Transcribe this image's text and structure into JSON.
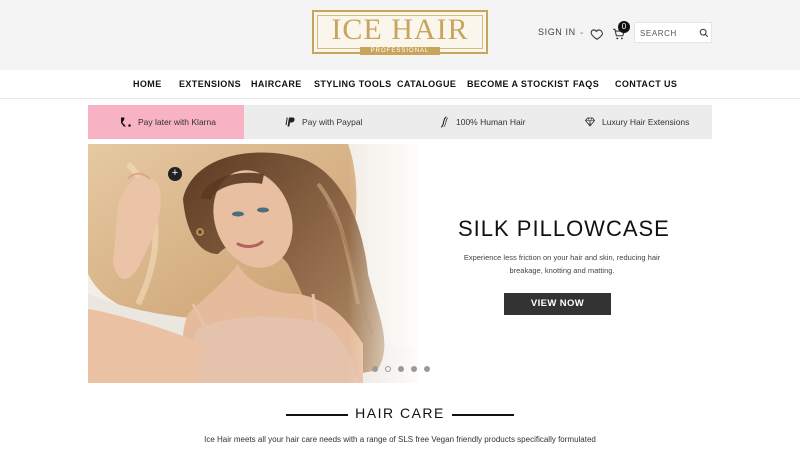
{
  "brand": {
    "logo_text": "ICE HAIR",
    "logo_subtext": "PROFESSIONAL",
    "gold": "#c9a55c"
  },
  "header": {
    "signin_label": "SIGN IN",
    "cart_count": "0",
    "search_placeholder": "SEARCH"
  },
  "nav": {
    "items": [
      {
        "label": "HOME"
      },
      {
        "label": "EXTENSIONS"
      },
      {
        "label": "HAIRCARE"
      },
      {
        "label": "STYLING TOOLS"
      },
      {
        "label": "CATALOGUE"
      },
      {
        "label": "BECOME A STOCKIST"
      },
      {
        "label": "FAQS"
      },
      {
        "label": "CONTACT US"
      }
    ]
  },
  "features": {
    "items": [
      {
        "label": "Pay later with Klarna",
        "icon": "klarna-icon"
      },
      {
        "label": "Pay with Paypal",
        "icon": "paypal-icon"
      },
      {
        "label": "100% Human Hair",
        "icon": "hair-strand-icon"
      },
      {
        "label": "Luxury Hair Extensions",
        "icon": "diamond-icon"
      }
    ],
    "klarna_color": "#f7b2c3"
  },
  "hero": {
    "title": "SILK PILLOWCASE",
    "description": "Experience less friction on your hair and skin, reducing hair breakage, knotting and matting.",
    "button_label": "VIEW NOW",
    "slide_count": 5,
    "active_slide": 2
  },
  "section": {
    "title": "HAIR CARE",
    "description": "Ice Hair meets all your hair care needs with a range of SLS free Vegan friendly products specifically formulated"
  }
}
